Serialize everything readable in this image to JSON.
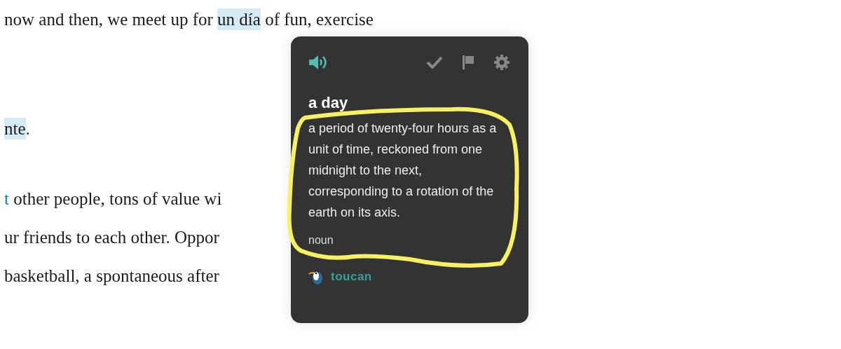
{
  "article": {
    "paragraphs": [
      {
        "lines": [
          [
            {
              "text": "now and then, we meet up for ",
              "kind": "plain"
            },
            {
              "text": "un día",
              "kind": "highlight"
            },
            {
              "text": " of fun, exercise",
              "kind": "plain"
            }
          ]
        ]
      },
      {
        "lines": [
          [
            {
              "text": "nte",
              "kind": "highlight"
            },
            {
              "text": ".",
              "kind": "plain"
            }
          ]
        ]
      },
      {
        "lines": [
          [
            {
              "text": "t",
              "kind": "link"
            },
            {
              "text": " other people, tons of value wi",
              "kind": "plain"
            }
          ],
          [
            {
              "text": "ur friends to each other. Oppor",
              "kind": "plain"
            }
          ],
          [
            {
              "text": "basketball, a spontaneous after",
              "kind": "plain"
            }
          ]
        ]
      }
    ]
  },
  "popup": {
    "term": "a day",
    "definition": "a period of twenty-four hours as a unit of time, reckoned from one midnight to the next, corresponding to a rotation of the earth on its axis.",
    "part_of_speech": "noun",
    "brand": "toucan"
  }
}
